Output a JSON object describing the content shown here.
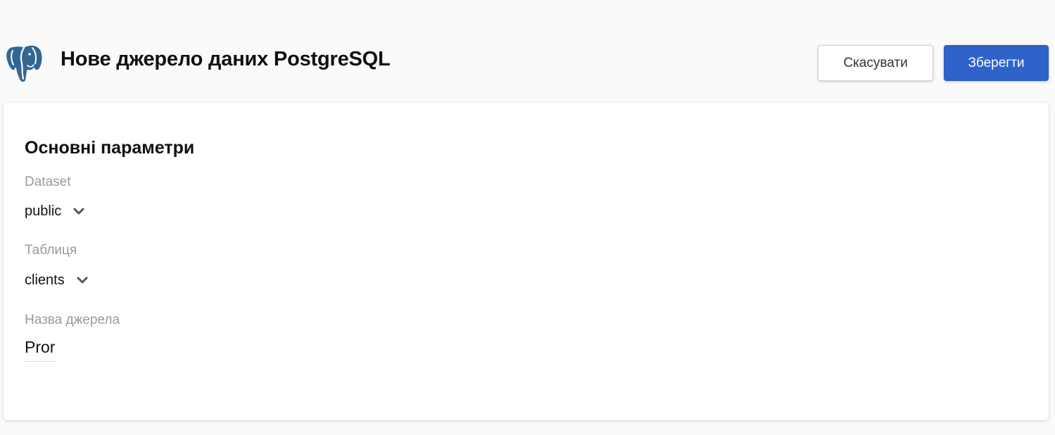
{
  "header": {
    "logo_icon": "postgresql-elephant-icon",
    "title": "Нове джерело даних PostgreSQL",
    "cancel_label": "Скасувати",
    "save_label": "Зберегти"
  },
  "form": {
    "section_title": "Основні параметри",
    "dataset": {
      "label": "Dataset",
      "value": "public"
    },
    "table": {
      "label": "Таблиця",
      "value": "clients"
    },
    "source_name": {
      "label": "Назва джерела",
      "value": "Pror"
    }
  },
  "colors": {
    "primary": "#2f62c9",
    "background": "#fafafa",
    "card": "#ffffff",
    "label": "#9a9a9a",
    "postgres_blue": "#336791"
  }
}
